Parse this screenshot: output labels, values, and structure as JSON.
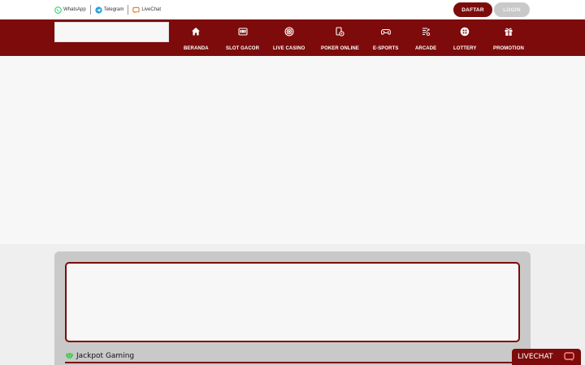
{
  "contacts": [
    {
      "label": "WhatsApp",
      "icon": "whatsapp-icon",
      "color": "#25d366"
    },
    {
      "label": "Telegram",
      "icon": "telegram-icon",
      "color": "#2aa1da"
    },
    {
      "label": "LiveChat",
      "icon": "livechat-icon",
      "color": "#e8701a"
    }
  ],
  "auth": {
    "register_label": "DAFTAR",
    "login_label": "LOGIN"
  },
  "nav": [
    {
      "label": "BERANDA",
      "icon": "home-icon"
    },
    {
      "label": "SLOT GACOR",
      "icon": "slot-machine-icon"
    },
    {
      "label": "LIVE CASINO",
      "icon": "roulette-icon"
    },
    {
      "label": "POKER ONLINE",
      "icon": "poker-icon"
    },
    {
      "label": "E-SPORTS",
      "icon": "gamepad-icon"
    },
    {
      "label": "ARCADE",
      "icon": "arcade-icon"
    },
    {
      "label": "LOTTERY",
      "icon": "lottery-icon"
    },
    {
      "label": "PROMOTION",
      "icon": "gift-icon"
    }
  ],
  "jackpot": {
    "title": "Jackpot Gaming",
    "icon": "gem-icon"
  },
  "livechat": {
    "label": "LIVECHAT",
    "icon": "chat-bubble-icon"
  },
  "colors": {
    "brand": "#7d0b0b",
    "login_button": "#c9c9c9",
    "background": "#f7f7f7"
  }
}
